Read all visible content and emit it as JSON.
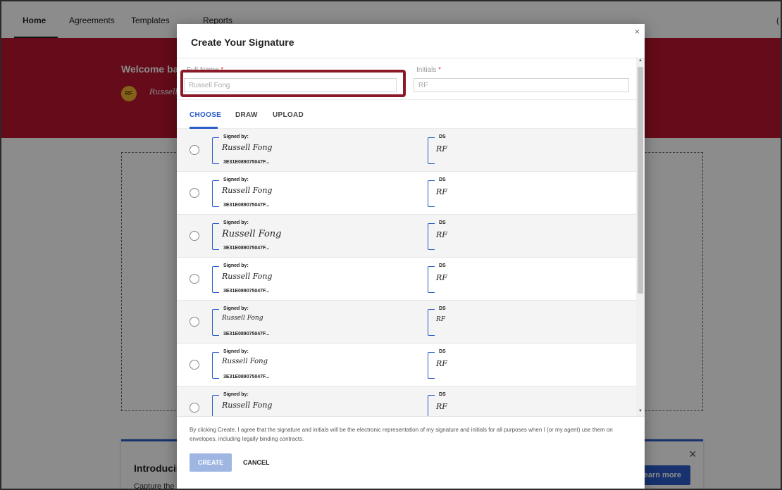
{
  "nav": {
    "tabs": [
      "Home",
      "Agreements",
      "Templates",
      "Reports"
    ],
    "active_tab": "Home"
  },
  "hero": {
    "welcome_text": "Welcome ba",
    "avatar_initials": "RF",
    "signature_preview": "Russell"
  },
  "intro_card": {
    "title": "Introducin",
    "description": "Capture the critical business value that's in your agreements with IAM",
    "learn_more_label": "Learn more",
    "close_label": "×"
  },
  "modal": {
    "title": "Create Your Signature",
    "close_label": "×",
    "full_name_label": "Full Name",
    "full_name_value": "Russell Fong",
    "initials_label": "Initials",
    "initials_value": "RF",
    "required_mark": "*",
    "tabs": [
      "CHOOSE",
      "DRAW",
      "UPLOAD"
    ],
    "active_tab": "CHOOSE",
    "options": [
      {
        "signed_by_label": "Signed by:",
        "signature": "Russell Fong",
        "id": "3E31E089075047F...",
        "ds_label": "DS",
        "initials": "RF"
      },
      {
        "signed_by_label": "Signed by:",
        "signature": "Russell Fong",
        "id": "3E31E089075047F...",
        "ds_label": "DS",
        "initials": "RF"
      },
      {
        "signed_by_label": "Signed by:",
        "signature": "Russell Fong",
        "id": "3E31E089075047F...",
        "ds_label": "DS",
        "initials": "RF"
      },
      {
        "signed_by_label": "Signed by:",
        "signature": "Russell Fong",
        "id": "3E31E089075047F...",
        "ds_label": "DS",
        "initials": "RF"
      },
      {
        "signed_by_label": "Signed by:",
        "signature": "Russell Fong",
        "id": "3E31E089075047F...",
        "ds_label": "DS",
        "initials": "RF"
      },
      {
        "signed_by_label": "Signed by:",
        "signature": "Russell Fong",
        "id": "3E31E089075047F...",
        "ds_label": "DS",
        "initials": "RF"
      },
      {
        "signed_by_label": "Signed by:",
        "signature": "Russell Fong",
        "id": "",
        "ds_label": "DS",
        "initials": "RF"
      }
    ],
    "disclaimer": "By clicking Create, I agree that the signature and initials will be the electronic representation of my signature and initials for all purposes when I (or my agent) use them on envelopes, including legally binding contracts.",
    "create_label": "CREATE",
    "cancel_label": "CANCEL"
  },
  "colors": {
    "brand_red": "#b8142f",
    "accent_blue": "#2b5cc8",
    "highlight_box": "#8b1a28"
  }
}
